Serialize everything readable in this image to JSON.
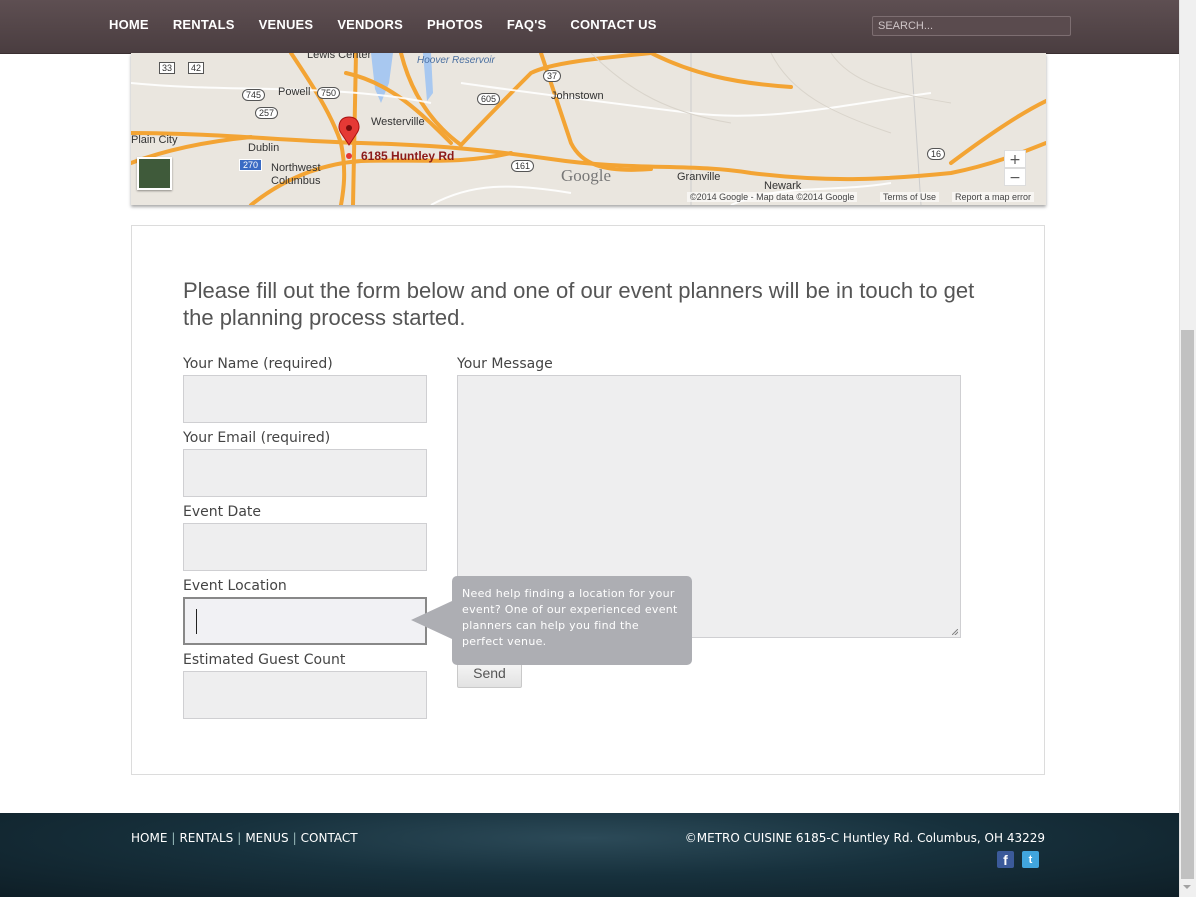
{
  "nav": {
    "items": [
      "HOME",
      "RENTALS",
      "VENUES",
      "VENDORS",
      "PHOTOS",
      "FAQ'S",
      "CONTACT US"
    ],
    "search_placeholder": "SEARCH..."
  },
  "map": {
    "address_label": "6185 Huntley Rd",
    "places": [
      "Lewis Center",
      "Hoover Reservoir",
      "Johnstown",
      "Powell",
      "Westerville",
      "Plain City",
      "Dublin",
      "Northwest",
      "Columbus",
      "Granville",
      "Newark"
    ],
    "route_shields": [
      "33",
      "42",
      "745",
      "750",
      "257",
      "270",
      "37",
      "605",
      "161",
      "16"
    ],
    "logo": "Google",
    "copyright": "©2014 Google - Map data ©2014 Google",
    "terms_link": "Terms of Use",
    "report_link": "Report a map error",
    "zoom_in": "+",
    "zoom_out": "−"
  },
  "form": {
    "intro": "Please fill out the form below and one of our event planners will be in touch to get the planning process started.",
    "name_label": "Your Name (required)",
    "email_label": "Your Email (required)",
    "date_label": "Event Date",
    "location_label": "Event Location",
    "guest_label": "Estimated Guest Count",
    "message_label": "Your Message",
    "send_label": "Send",
    "tooltip": "Need help finding a location for your event? One of our experienced event planners can help you find the perfect venue."
  },
  "footer": {
    "links": [
      "HOME",
      "RENTALS",
      "MENUS",
      "CONTACT"
    ],
    "copyright": "©METRO CUISINE 6185-C Huntley Rd. Columbus, OH 43229",
    "facebook": "f",
    "twitter": "t"
  },
  "colors": {
    "nav_bg": "#4f4245",
    "footer_bg": "#17313d",
    "tooltip_bg": "#adaeb3",
    "field_bg": "#eeeeef",
    "map_pin": "#e53935",
    "map_road": "#f3a434"
  }
}
